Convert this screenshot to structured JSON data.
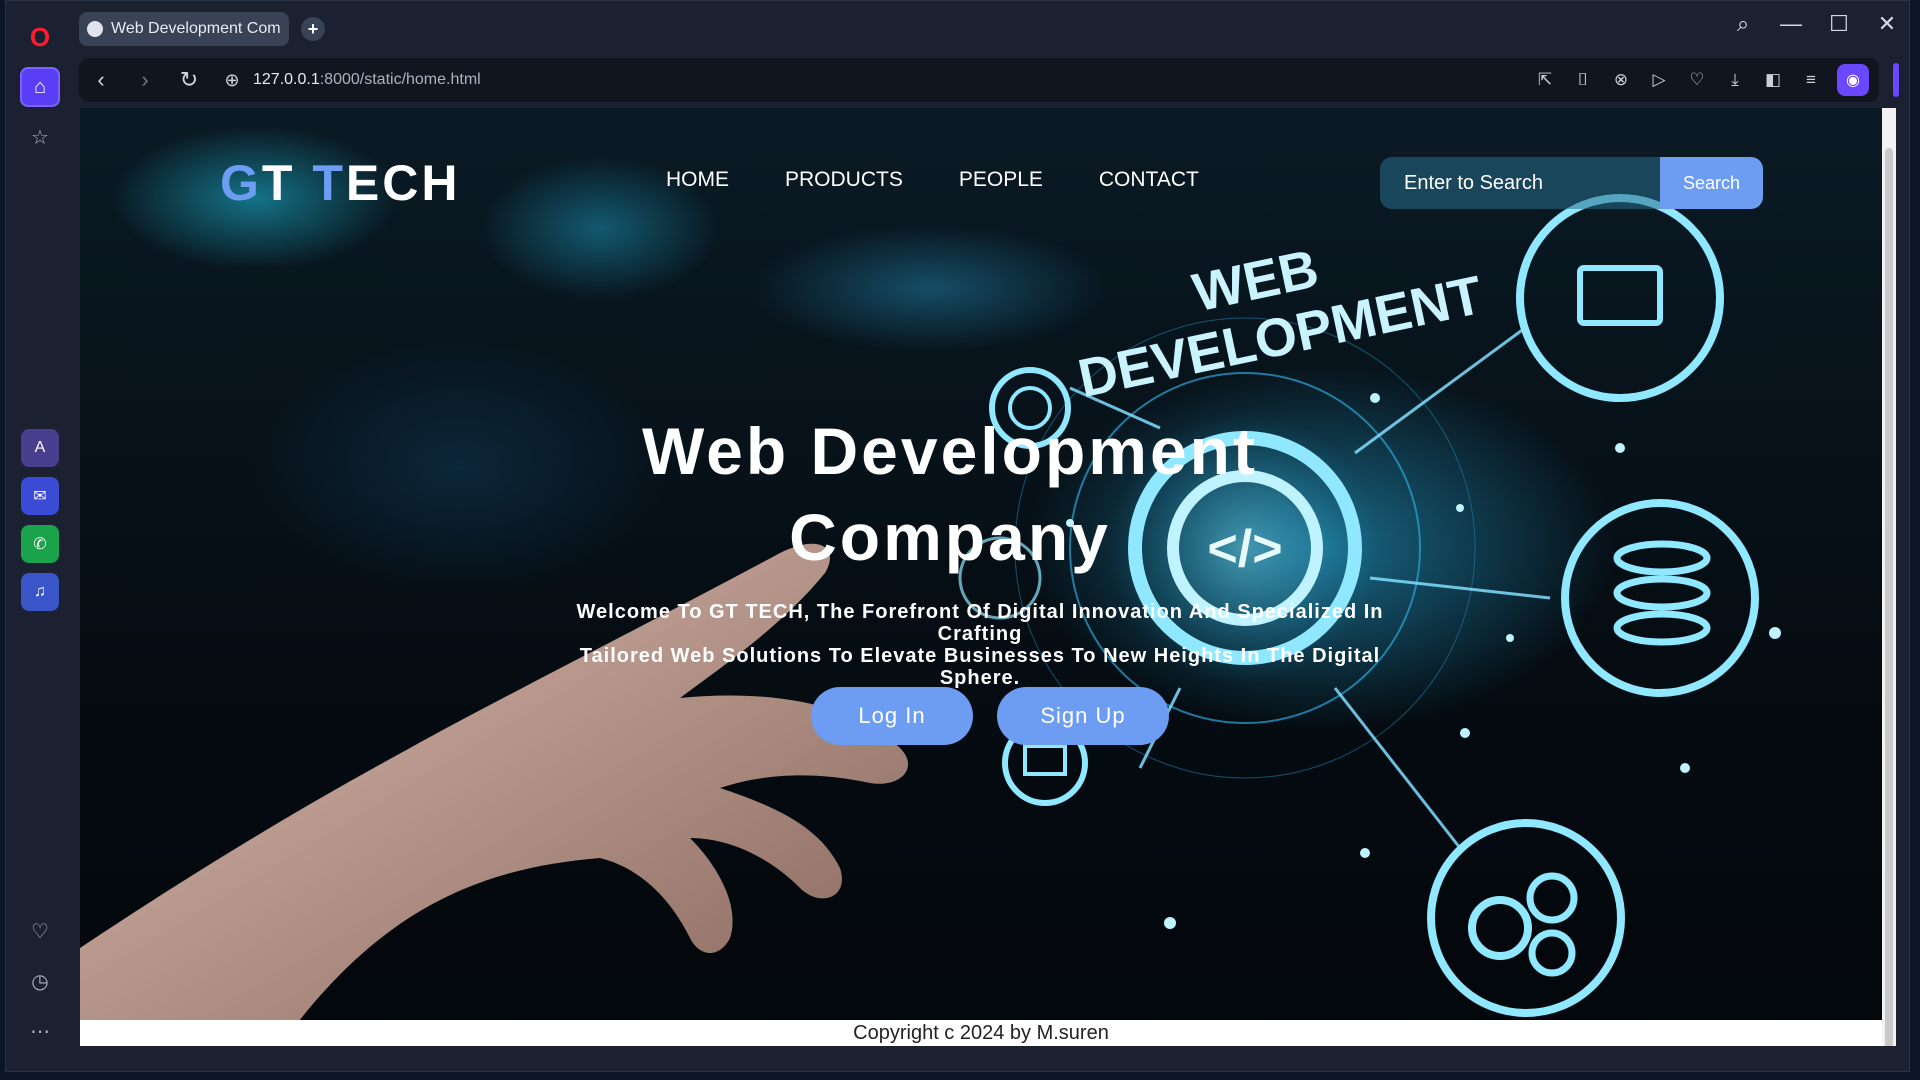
{
  "browser": {
    "tab_title": "Web Development Compa",
    "new_tab_label": "+",
    "url_host": "127.0.0.1",
    "url_rest": ":8000/static/home.html",
    "icons": {
      "back": "chevron-left-icon",
      "forward": "chevron-right-icon",
      "reload": "reload-icon",
      "site_info": "globe-icon"
    }
  },
  "site": {
    "logo": {
      "part1": "G",
      "part2": "T ",
      "part3": "T",
      "part4": "ECH"
    },
    "nav": [
      "HOME",
      "PRODUCTS",
      "PEOPLE",
      "CONTACT"
    ],
    "search": {
      "placeholder": "Enter to Search",
      "button": "Search"
    },
    "hero": {
      "title_line1": "Web Development",
      "title_line2": "Company",
      "subtitle_line1": "Welcome To GT TECH, The Forefront Of Digital Innovation And Specialized In Crafting",
      "subtitle_line2": "Tailored Web Solutions To Elevate Businesses To New Heights In The Digital Sphere.",
      "login": "Log In",
      "signup": "Sign Up"
    },
    "footer": "Copyright c 2024 by M.suren"
  },
  "art": {
    "badge_line1": "WEB",
    "badge_line2": "DEVELOPMENT",
    "code_glyph": "</>"
  },
  "colors": {
    "accent": "#6d9cf3",
    "browser_accent": "#6a48ff",
    "glow": "#2ec4f0"
  }
}
